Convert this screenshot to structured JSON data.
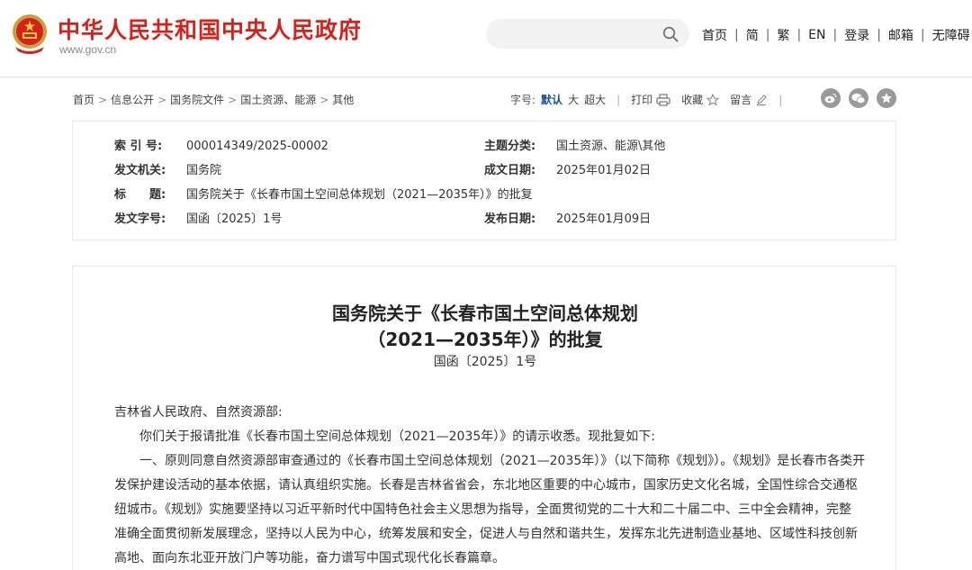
{
  "header": {
    "site_title": "中华人民共和国中央人民政府",
    "site_url": "www.gov.cn",
    "search": {
      "value": "",
      "placeholder": ""
    },
    "nav": [
      "首页",
      "简",
      "繁",
      "EN",
      "登录",
      "邮箱",
      "无障碍"
    ],
    "nav_separator": "|"
  },
  "breadcrumb": {
    "items": [
      "首页",
      "信息公开",
      "国务院文件",
      "国土资源、能源",
      "其他"
    ],
    "separator": ">"
  },
  "tools": {
    "font_size_label": "字号:",
    "font_sizes": [
      "默认",
      "大",
      "超大"
    ],
    "active_font_size": "默认",
    "separator": "|",
    "print": "打印",
    "favorite": "收藏",
    "comment": "留言"
  },
  "share_icons": [
    "weibo-icon",
    "wechat-icon",
    "qzone-icon"
  ],
  "info": {
    "left": [
      {
        "key": "索 引 号:",
        "value": "000014349/2025-00002"
      },
      {
        "key": "发文机关:",
        "value": "国务院"
      },
      {
        "key": "标　　题:",
        "value": "国务院关于《长春市国土空间总体规划（2021—2035年）》的批复"
      },
      {
        "key": "发文字号:",
        "value": "国函〔2025〕1号"
      }
    ],
    "right": [
      {
        "key": "主题分类:",
        "value": "国土资源、能源\\其他"
      },
      {
        "key": "成文日期:",
        "value": "2025年01月02日"
      },
      {
        "key": "发布日期:",
        "value": "2025年01月09日"
      }
    ]
  },
  "document": {
    "title_line1": "国务院关于《长春市国土空间总体规划",
    "title_line2": "（2021—2035年）》的批复",
    "number": "国函〔2025〕1号",
    "paragraphs": [
      "吉林省人民政府、自然资源部:",
      "你们关于报请批准《长春市国土空间总体规划（2021—2035年）》的请示收悉。现批复如下:",
      "一、原则同意自然资源部审查通过的《长春市国土空间总体规划（2021—2035年）》（以下简称《规划》）。《规划》是长春市各类开",
      "发保护建设活动的基本依据，请认真组织实施。长春是吉林省省会，东北地区重要的中心城市，国家历史文化名城，全国性综合交通枢",
      "纽城市。《规划》实施要坚持以习近平新时代中国特色社会主义思想为指导，全面贯彻党的二十大和二十届二中、三中全会精神，完整",
      "准确全面贯彻新发展理念，坚持以人民为中心，统筹发展和安全，促进人与自然和谐共生，发挥东北先进制造业基地、区域性科技创新",
      "高地、面向东北亚开放门户等功能，奋力谱写中国式现代化长春篇章。"
    ]
  },
  "colors": {
    "brand_red": "#d7211b",
    "active_blue": "#1a4ea2",
    "icon_gray": "#9a9a9a"
  }
}
